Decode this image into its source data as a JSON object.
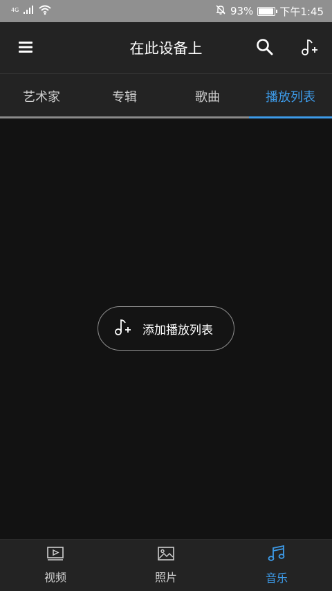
{
  "status_bar": {
    "network": "4G",
    "battery_percent": "93%",
    "battery_level": 0.93,
    "time": "下午1:45",
    "icons": [
      "signal-icon",
      "wifi-icon",
      "mute-bell-icon",
      "battery-icon"
    ]
  },
  "app_bar": {
    "title": "在此设备上",
    "icons": [
      "menu-icon",
      "search-icon",
      "add-music-icon"
    ]
  },
  "tabs": [
    {
      "label": "艺术家",
      "active": false
    },
    {
      "label": "专辑",
      "active": false
    },
    {
      "label": "歌曲",
      "active": false
    },
    {
      "label": "播放列表",
      "active": true
    }
  ],
  "main": {
    "add_playlist_label": "添加播放列表",
    "add_playlist_icon": "add-music-icon"
  },
  "bottom_nav": [
    {
      "label": "视频",
      "icon": "video-icon",
      "active": false
    },
    {
      "label": "照片",
      "icon": "photo-icon",
      "active": false
    },
    {
      "label": "音乐",
      "icon": "music-icon",
      "active": true
    }
  ],
  "colors": {
    "accent": "#3d9be9",
    "status_bar": "#909090",
    "bar_bg": "#232323",
    "content_bg": "#121212"
  }
}
